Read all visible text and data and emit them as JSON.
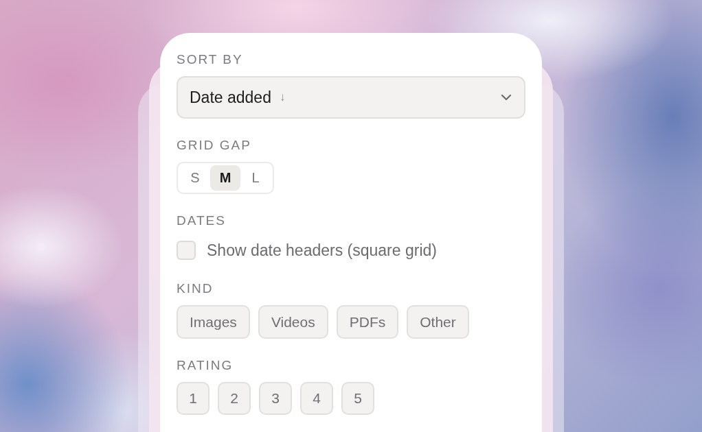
{
  "sort_by": {
    "label": "SORT BY",
    "value": "Date added",
    "direction": "↓"
  },
  "grid_gap": {
    "label": "GRID GAP",
    "options": [
      {
        "label": "S",
        "selected": false
      },
      {
        "label": "M",
        "selected": true
      },
      {
        "label": "L",
        "selected": false
      }
    ]
  },
  "dates": {
    "label": "DATES",
    "checkbox": {
      "label": "Show date headers (square grid)",
      "checked": false
    }
  },
  "kind": {
    "label": "KIND",
    "chips": [
      {
        "label": "Images",
        "selected": false
      },
      {
        "label": "Videos",
        "selected": false
      },
      {
        "label": "PDFs",
        "selected": false
      },
      {
        "label": "Other",
        "selected": false
      }
    ]
  },
  "rating": {
    "label": "RATING",
    "options": [
      {
        "label": "1",
        "selected": false
      },
      {
        "label": "2",
        "selected": false
      },
      {
        "label": "3",
        "selected": false
      },
      {
        "label": "4",
        "selected": false
      },
      {
        "label": "5",
        "selected": false
      }
    ]
  }
}
